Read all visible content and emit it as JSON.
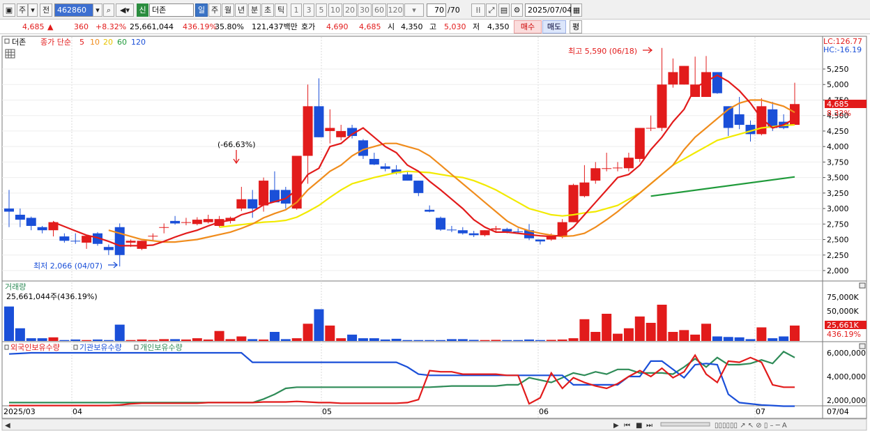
{
  "toolbar": {
    "type_label": "주",
    "prev_label": "전",
    "stock_code": "462860",
    "sin_label": "신",
    "stock_name": "더존",
    "periods": [
      "일",
      "주",
      "월",
      "년",
      "분",
      "초",
      "틱"
    ],
    "active_period": "일",
    "intervals": [
      "1",
      "3",
      "5",
      "10",
      "20",
      "30",
      "60",
      "120"
    ],
    "count": "70",
    "count_total": "/70",
    "date": "2025/07/04"
  },
  "quote": {
    "price": "4,685",
    "arrow": "▲",
    "change": "360",
    "change_pct": "+8.32%",
    "volume": "25,661,044",
    "volume_pct": "436.19%",
    "turnover": "35.80%",
    "amount": "121,437백만",
    "hoga_label": "호가",
    "hoga_sell": "4,690",
    "hoga_buy": "4,685",
    "open_label": "시",
    "open": "4,350",
    "high_label": "고",
    "high": "5,030",
    "low_label": "저",
    "low": "4,350",
    "buy_label": "매수",
    "sell_label": "매도",
    "flat_label": "평"
  },
  "price_panel": {
    "legend_name": "더존",
    "legend_ma": "종가 단순",
    "ma_periods": [
      "5",
      "10",
      "20",
      "60",
      "120"
    ],
    "ma_colors": [
      "#e21b1b",
      "#f08c1c",
      "#e8d400",
      "#1f9a3a",
      "#1a4fd8"
    ],
    "lc": "LC:126.77",
    "hc": "HC:-16.19",
    "high_annot": "최고 5,590 (06/18)",
    "low_annot": "최저 2,066 (04/07)",
    "drop_annot": "(-66.63%)",
    "price_tag": "4,685",
    "pct_tag": "8.32%",
    "y_ticks": [
      "5,250",
      "5,000",
      "4,750",
      "4,500",
      "4,250",
      "4,000",
      "3,750",
      "3,500",
      "3,250",
      "3,000",
      "2,750",
      "2,500",
      "2,250",
      "2,000"
    ]
  },
  "volume_panel": {
    "title": "거래량",
    "info": "25,661,044주(436.19%)",
    "y_ticks": [
      "75,000K",
      "50,000K"
    ],
    "vol_tag": "25,661K",
    "vol_pct_tag": "436.19%"
  },
  "holdings_panel": {
    "legends": [
      "외국인보유수량",
      "기관보유수량",
      "개인보유수량"
    ],
    "legend_colors": [
      "#e21b1b",
      "#1a4fd8",
      "#2e8b57"
    ],
    "y_ticks": [
      "6,000,000",
      "4,000,000",
      "2,000,000"
    ]
  },
  "x_axis": {
    "labels": [
      "2025/03",
      "04",
      "05",
      "06",
      "07",
      "07/04"
    ]
  },
  "chart_data": {
    "type": "candlestick",
    "ylim": [
      1850,
      5650
    ],
    "candles": [
      [
        3000,
        3300,
        2700,
        2950
      ],
      [
        2900,
        3000,
        2700,
        2820
      ],
      [
        2850,
        2870,
        2650,
        2720
      ],
      [
        2700,
        2720,
        2600,
        2650
      ],
      [
        2650,
        2800,
        2550,
        2780
      ],
      [
        2550,
        2600,
        2450,
        2480
      ],
      [
        2480,
        2600,
        2430,
        2470
      ],
      [
        2450,
        2570,
        2350,
        2560
      ],
      [
        2600,
        2620,
        2400,
        2430
      ],
      [
        2380,
        2420,
        2250,
        2330
      ],
      [
        2700,
        2760,
        2066,
        2250
      ],
      [
        2450,
        2500,
        2380,
        2480
      ],
      [
        2350,
        2480,
        2330,
        2480
      ],
      [
        2550,
        2600,
        2480,
        2560
      ],
      [
        2700,
        2760,
        2600,
        2700
      ],
      [
        2800,
        2880,
        2740,
        2760
      ],
      [
        2780,
        2850,
        2730,
        2780
      ],
      [
        2750,
        2860,
        2730,
        2820
      ],
      [
        2780,
        2900,
        2760,
        2830
      ],
      [
        2720,
        2880,
        2700,
        2830
      ],
      [
        2800,
        2870,
        2760,
        2850
      ],
      [
        3000,
        3350,
        2960,
        3150
      ],
      [
        3150,
        3300,
        2850,
        3000
      ],
      [
        3050,
        3500,
        2950,
        3450
      ],
      [
        3300,
        3600,
        3100,
        3100
      ],
      [
        3300,
        3350,
        3000,
        3080
      ],
      [
        3000,
        3850,
        2980,
        3850
      ],
      [
        3850,
        5000,
        3400,
        4650
      ],
      [
        4650,
        5100,
        4150,
        4150
      ],
      [
        4250,
        4600,
        4050,
        4300
      ],
      [
        4150,
        4350,
        4100,
        4250
      ],
      [
        4300,
        4350,
        4130,
        4170
      ],
      [
        4100,
        4120,
        3800,
        3850
      ],
      [
        3800,
        3900,
        3700,
        3710
      ],
      [
        3680,
        3730,
        3600,
        3640
      ],
      [
        3630,
        3700,
        3550,
        3570
      ],
      [
        3550,
        3600,
        3450,
        3450
      ],
      [
        3450,
        3450,
        3200,
        3250
      ],
      [
        2980,
        3050,
        2940,
        2950
      ],
      [
        2850,
        2870,
        2640,
        2660
      ],
      [
        2660,
        2720,
        2620,
        2650
      ],
      [
        2650,
        2700,
        2580,
        2600
      ],
      [
        2600,
        2640,
        2540,
        2570
      ],
      [
        2570,
        2650,
        2550,
        2650
      ],
      [
        2660,
        2720,
        2620,
        2680
      ],
      [
        2670,
        2690,
        2600,
        2630
      ],
      [
        2630,
        2680,
        2590,
        2620
      ],
      [
        2650,
        2750,
        2490,
        2520
      ],
      [
        2500,
        2500,
        2420,
        2470
      ],
      [
        2500,
        2600,
        2480,
        2550
      ],
      [
        2550,
        2830,
        2520,
        2780
      ],
      [
        2780,
        3400,
        2780,
        3380
      ],
      [
        3200,
        3700,
        3180,
        3420
      ],
      [
        3450,
        3750,
        3400,
        3650
      ],
      [
        3650,
        3900,
        3600,
        3650
      ],
      [
        3650,
        3750,
        3600,
        3660
      ],
      [
        3650,
        3900,
        3600,
        3820
      ],
      [
        3800,
        4300,
        3750,
        4300
      ],
      [
        4300,
        4500,
        4250,
        4300
      ],
      [
        4300,
        5590,
        4250,
        5000
      ],
      [
        5000,
        5420,
        4950,
        5200
      ],
      [
        5000,
        5300,
        5000,
        5300
      ],
      [
        4800,
        5450,
        4800,
        5000
      ],
      [
        4800,
        5460,
        4800,
        5200
      ],
      [
        5200,
        5200,
        4850,
        4860
      ],
      [
        4650,
        4650,
        4170,
        4300
      ],
      [
        4520,
        4800,
        4280,
        4350
      ],
      [
        4350,
        4420,
        4080,
        4200
      ],
      [
        4200,
        4780,
        4180,
        4650
      ],
      [
        4600,
        4720,
        4250,
        4300
      ],
      [
        4400,
        4520,
        4280,
        4300
      ],
      [
        4350,
        5030,
        4350,
        4685
      ]
    ],
    "volume": [
      19,
      7,
      1.5,
      1.5,
      2,
      0.5,
      0.8,
      0.5,
      0.8,
      0.5,
      9,
      0.5,
      0.8,
      0.5,
      1,
      1,
      0.8,
      1.5,
      0.8,
      5.5,
      1,
      2.5,
      1,
      0.8,
      5,
      1,
      1.5,
      9.5,
      17.5,
      8.5,
      1.5,
      3.5,
      1.5,
      1.5,
      0.8,
      1.2,
      0.5,
      0.5,
      0.5,
      0.5,
      1,
      1,
      0.6,
      0.5,
      0.6,
      0.5,
      0.5,
      0.8,
      0.5,
      0.6,
      0.8,
      1.5,
      12,
      5,
      15,
      4,
      7,
      13.5,
      10,
      20,
      5,
      6,
      3.5,
      9.5,
      2.5,
      2.2,
      2,
      1,
      7.5,
      1.5,
      2.5,
      8.5
    ],
    "ma5": [
      null,
      null,
      null,
      null,
      2780,
      2710,
      2640,
      2570,
      2530,
      2470,
      2400,
      2400,
      2400,
      2410,
      2470,
      2540,
      2600,
      2650,
      2720,
      2780,
      2810,
      2900,
      2950,
      3060,
      3110,
      3160,
      3300,
      3550,
      3650,
      4000,
      4050,
      4200,
      4300,
      4150,
      4000,
      3900,
      3700,
      3600,
      3440,
      3300,
      3150,
      3000,
      2820,
      2700,
      2620,
      2620,
      2600,
      2580,
      2560,
      2550,
      2570,
      2700,
      2900,
      3100,
      3300,
      3500,
      3550,
      3700,
      3950,
      4150,
      4400,
      4600,
      4950,
      5050,
      5150,
      5050,
      4900,
      4700,
      4450,
      4300,
      4350,
      4450
    ],
    "ma10": [
      null,
      null,
      null,
      null,
      null,
      null,
      null,
      null,
      null,
      2650,
      2600,
      2550,
      2500,
      2480,
      2460,
      2460,
      2480,
      2500,
      2540,
      2580,
      2620,
      2680,
      2750,
      2850,
      2920,
      2980,
      3100,
      3300,
      3450,
      3600,
      3700,
      3850,
      3950,
      4000,
      4050,
      4050,
      4000,
      3950,
      3850,
      3700,
      3550,
      3400,
      3250,
      3100,
      2950,
      2800,
      2700,
      2640,
      2600,
      2570,
      2550,
      2560,
      2600,
      2700,
      2820,
      2950,
      3100,
      3250,
      3400,
      3550,
      3700,
      3950,
      4150,
      4300,
      4450,
      4600,
      4700,
      4750,
      4750,
      4700,
      4650,
      4550
    ],
    "ma20": [
      null,
      null,
      null,
      null,
      null,
      null,
      null,
      null,
      null,
      null,
      null,
      null,
      null,
      null,
      null,
      null,
      null,
      null,
      null,
      2700,
      2720,
      2740,
      2760,
      2780,
      2790,
      2810,
      2860,
      2950,
      3050,
      3180,
      3300,
      3400,
      3450,
      3500,
      3540,
      3580,
      3600,
      3590,
      3580,
      3550,
      3520,
      3500,
      3450,
      3380,
      3300,
      3200,
      3100,
      3000,
      2950,
      2900,
      2880,
      2900,
      2930,
      2950,
      3000,
      3050,
      3150,
      3250,
      3400,
      3550,
      3700,
      3800,
      3900,
      4000,
      4100,
      4150,
      4200,
      4250,
      4300,
      4320,
      4340,
      4350
    ],
    "ma60_segment": [
      [
        58,
        3200
      ],
      [
        71,
        3510
      ]
    ],
    "foreign": [
      1.55,
      1.55,
      1.55,
      1.55,
      1.55,
      1.55,
      1.55,
      1.55,
      1.55,
      1.55,
      1.6,
      1.7,
      1.75,
      1.75,
      1.75,
      1.75,
      1.75,
      1.75,
      1.8,
      1.8,
      1.8,
      1.8,
      1.8,
      1.85,
      1.85,
      1.85,
      1.9,
      1.85,
      1.8,
      1.8,
      1.75,
      1.75,
      1.75,
      1.75,
      1.75,
      1.75,
      1.8,
      2.05,
      4.5,
      4.4,
      4.4,
      4.2,
      4.2,
      4.2,
      4.2,
      4.1,
      4.1,
      1.7,
      2.2,
      4.3,
      3.0,
      3.9,
      3.5,
      3.2,
      3.0,
      3.4,
      4.0,
      4.5,
      4.0,
      4.7,
      3.9,
      4.4,
      5.8,
      4.2,
      3.5,
      5.3,
      5.2,
      5.6,
      5.2,
      3.3,
      3.1,
      3.1
    ],
    "institution": [
      5.9,
      5.95,
      6.0,
      6.0,
      6.0,
      6.0,
      6.0,
      6.0,
      6.0,
      6.0,
      6.0,
      6.0,
      6.0,
      6.0,
      6.0,
      6.0,
      6.0,
      6.0,
      6.0,
      6.0,
      6.0,
      6.0,
      5.2,
      5.2,
      5.2,
      5.2,
      5.2,
      5.2,
      5.2,
      5.2,
      5.2,
      5.2,
      5.2,
      5.2,
      5.2,
      5.2,
      4.8,
      4.2,
      4.1,
      4.1,
      4.1,
      4.1,
      4.1,
      4.1,
      4.1,
      4.1,
      4.1,
      4.1,
      4.1,
      4.1,
      4.1,
      3.3,
      3.3,
      3.3,
      3.3,
      3.3,
      4.0,
      4.0,
      5.3,
      5.3,
      4.6,
      3.9,
      5.0,
      5.1,
      5.0,
      2.5,
      1.8,
      1.7,
      1.6,
      1.55,
      1.5,
      1.5
    ],
    "individual": [
      1.8,
      1.8,
      1.8,
      1.8,
      1.8,
      1.8,
      1.8,
      1.8,
      1.8,
      1.8,
      1.8,
      1.8,
      1.8,
      1.8,
      1.8,
      1.8,
      1.8,
      1.8,
      1.8,
      1.8,
      1.8,
      1.8,
      1.8,
      2.1,
      2.5,
      3.0,
      3.1,
      3.1,
      3.1,
      3.1,
      3.1,
      3.1,
      3.1,
      3.1,
      3.1,
      3.1,
      3.1,
      3.1,
      3.1,
      3.15,
      3.2,
      3.2,
      3.2,
      3.2,
      3.2,
      3.3,
      3.3,
      3.9,
      3.7,
      3.5,
      3.9,
      4.3,
      4.1,
      4.4,
      4.2,
      4.6,
      4.6,
      4.3,
      4.3,
      4.3,
      4.2,
      4.8,
      5.5,
      4.8,
      5.6,
      5.0,
      5.0,
      5.1,
      5.4,
      5.1,
      6.1,
      5.6
    ]
  }
}
